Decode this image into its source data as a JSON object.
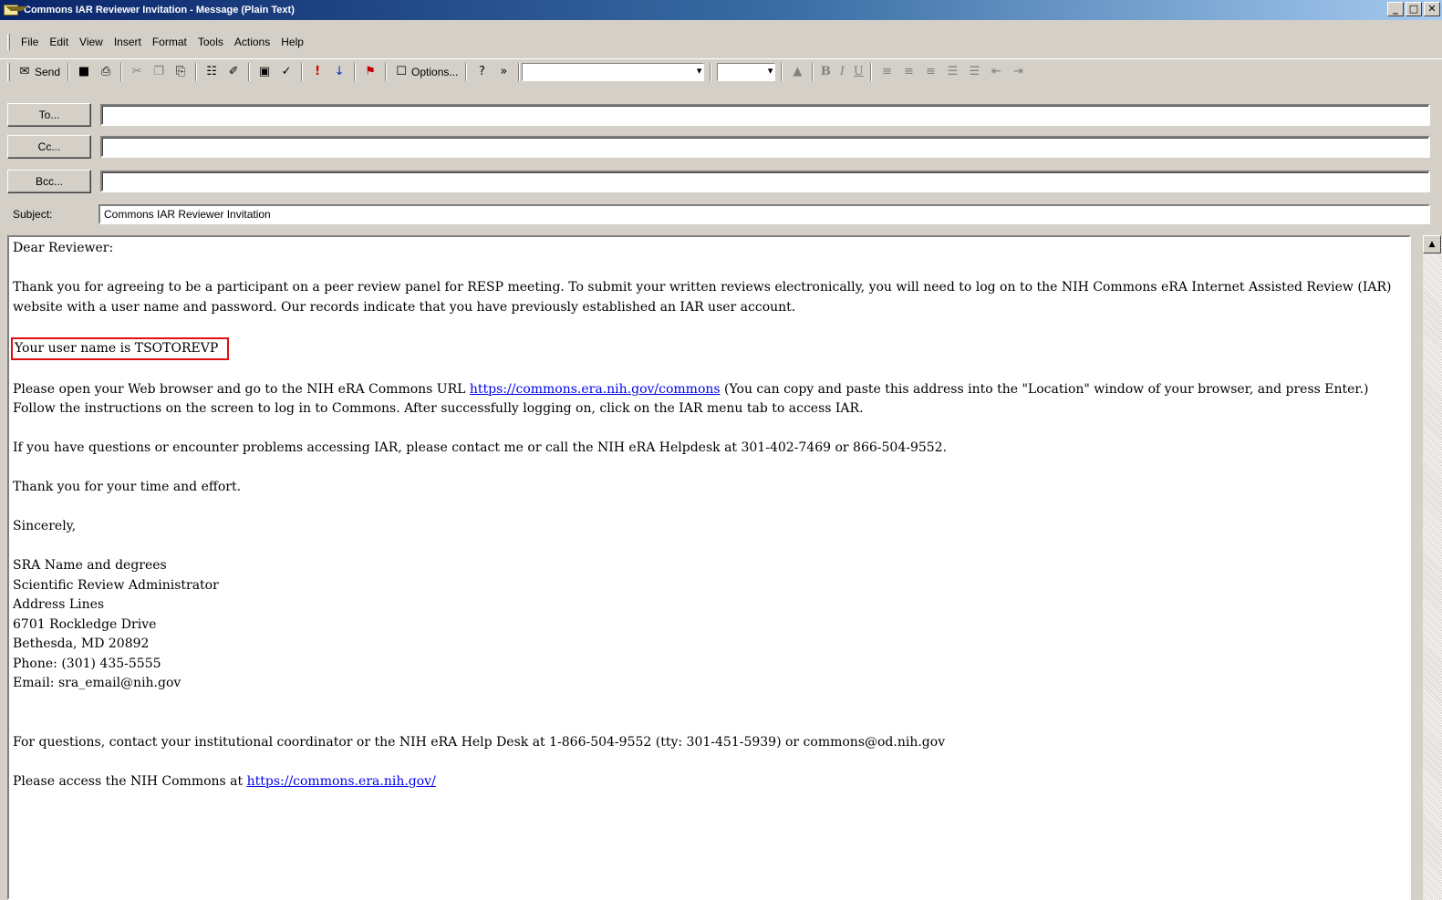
{
  "window": {
    "title": "Commons IAR Reviewer Invitation - Message (Plain Text)",
    "buttons": [
      "_",
      "□",
      "✕"
    ]
  },
  "menu": [
    "File",
    "Edit",
    "View",
    "Insert",
    "Format",
    "Tools",
    "Actions",
    "Help"
  ],
  "toolbar": {
    "send_label": "Send",
    "options_label": "Options...",
    "format_buttons": [
      "B",
      "I",
      "U"
    ]
  },
  "fields": {
    "to_label": "To...",
    "cc_label": "Cc...",
    "bcc_label": "Bcc...",
    "subject_label": "Subject:",
    "to_value": "",
    "cc_value": "",
    "bcc_value": "",
    "subject_value": "Commons IAR Reviewer Invitation"
  },
  "body": {
    "greeting": "Dear Reviewer:",
    "para1": "Thank you for agreeing to be a participant on a peer review panel for  RESP meeting. To submit your written reviews electronically, you will need to log on to the NIH Commons eRA Internet Assisted Review (IAR) website with a user name and password. Our records indicate that you have previously established an IAR user account.",
    "username": "Your user name is TSOTOREVP",
    "para2_before": "Please open your Web browser and go to the NIH eRA Commons URL ",
    "para2_link": "https://commons.era.nih.gov/commons",
    "para2_after": " (You can copy and paste this address into the \"Location\" window of your browser, and press Enter.) Follow the instructions on the screen to log in to Commons. After successfully logging on, click on the IAR menu tab to access IAR.",
    "para3": "If you have questions or encounter problems accessing IAR, please contact me or call the NIH eRA Helpdesk at 301-402-7469 or 866-504-9552.",
    "thanks": "Thank you for your time and effort.",
    "closing": "Sincerely,",
    "signature": [
      "SRA Name and degrees",
      "Scientific Review Administrator",
      "Address Lines",
      "6701 Rockledge Drive",
      "Bethesda, MD 20892",
      "Phone: (301) 435-5555",
      "Email: sra_email@nih.gov"
    ],
    "para4": "For questions, contact your institutional coordinator or the NIH eRA Help Desk at  1-866-504-9552 (tty: 301-451-5939) or commons@od.nih.gov",
    "para5_before": "Please access the NIH Commons at ",
    "para5_link": "https://commons.era.nih.gov/"
  }
}
